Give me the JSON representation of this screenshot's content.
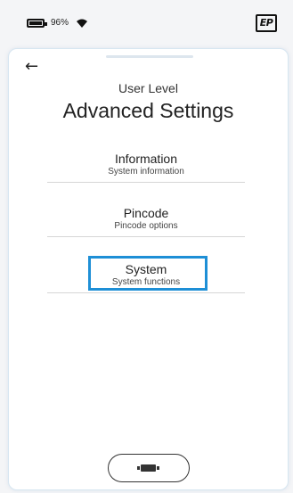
{
  "status_bar": {
    "battery_percent": "96%",
    "battery_icon": "battery-icon",
    "wifi_icon": "wifi-icon",
    "logo_text": "EP"
  },
  "header": {
    "back_icon": "back-arrow-icon",
    "back_glyph": "←",
    "subtitle": "User Level",
    "title": "Advanced Settings"
  },
  "menu": {
    "items": [
      {
        "label": "Information",
        "description": "System information"
      },
      {
        "label": "Pincode",
        "description": "Pincode options"
      },
      {
        "label": "System",
        "description": "System functions"
      }
    ],
    "selected_index": 2,
    "accent_color": "#1e8fd6"
  },
  "footer": {
    "button_icon": "keyboard-icon"
  }
}
